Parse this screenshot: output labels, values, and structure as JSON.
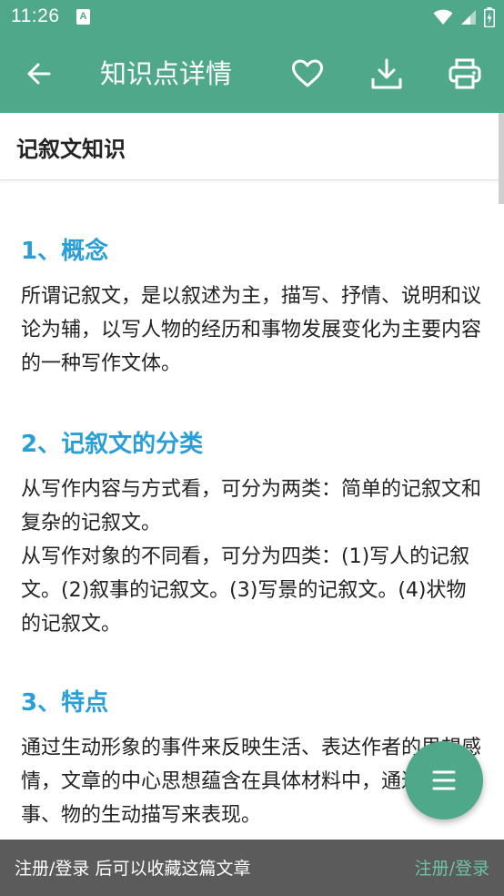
{
  "status_bar": {
    "time": "11:26",
    "notif_glyph": "A"
  },
  "toolbar": {
    "title": "知识点详情",
    "back_icon": "arrow-back-icon",
    "favorite_icon": "heart-icon",
    "download_icon": "download-icon",
    "print_icon": "print-icon"
  },
  "article": {
    "title": "记叙文知识",
    "sections": [
      {
        "heading": "1、概念",
        "paragraphs": [
          "所谓记叙文，是以叙述为主，描写、抒情、说明和议论为辅，以写人物的经历和事物发展变化为主要内容的一种写作文体。"
        ]
      },
      {
        "heading": "2、记叙文的分类",
        "paragraphs": [
          "从写作内容与方式看，可分为两类：简单的记叙文和复杂的记叙文。",
          "从写作对象的不同看，可分为四类：(1)写人的记叙文。(2)叙事的记叙文。(3)写景的记叙文。(4)状物的记叙文。"
        ]
      },
      {
        "heading": "3、特点",
        "paragraphs": [
          "通过生动形象的事件来反映生活、表达作者的思想感情，文章的中心思想蕴含在具体材料中，通过对人、事、物的生动描写来表现。"
        ]
      }
    ]
  },
  "fab": {
    "icon": "menu-icon"
  },
  "snackbar": {
    "message": "注册/登录 后可以收藏这篇文章",
    "action": "注册/登录"
  },
  "colors": {
    "primary": "#4fa88a",
    "heading": "#2a9fd6",
    "snackbar": "#5b5b5b",
    "snack_action": "#6fc3a4"
  }
}
